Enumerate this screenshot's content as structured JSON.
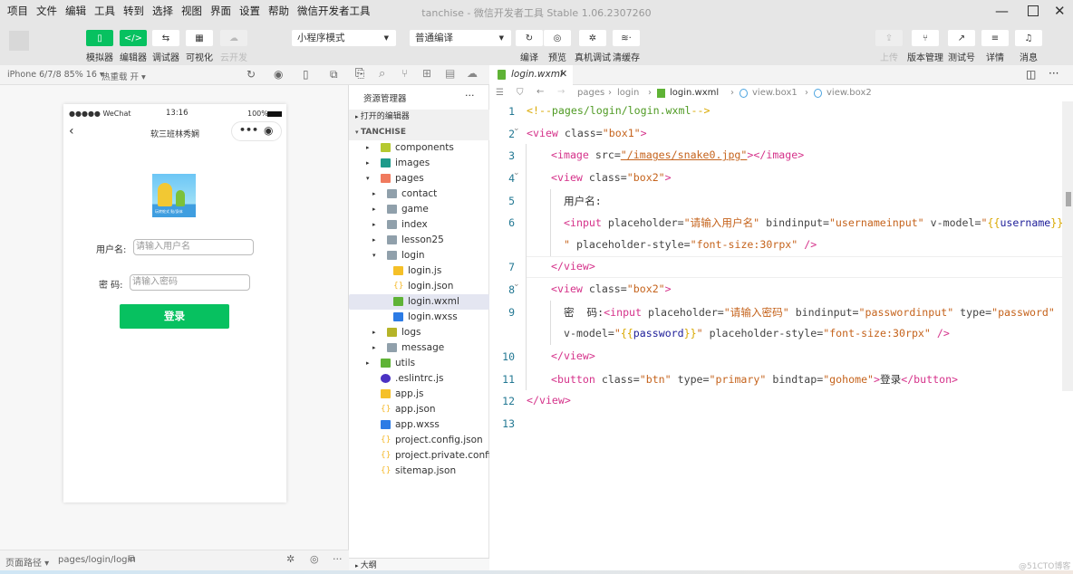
{
  "menu": [
    "项目",
    "文件",
    "编辑",
    "工具",
    "转到",
    "选择",
    "视图",
    "界面",
    "设置",
    "帮助",
    "微信开发者工具"
  ],
  "window_title": "tanchise - 微信开发者工具 Stable 1.06.2307260",
  "toolbar": {
    "left": [
      {
        "label": "模拟器",
        "icon": "phone-icon",
        "active": true
      },
      {
        "label": "编辑器",
        "icon": "code-icon",
        "active": true
      },
      {
        "label": "调试器",
        "icon": "debug-icon"
      },
      {
        "label": "可视化",
        "icon": "layout-icon"
      },
      {
        "label": "云开发",
        "icon": "cloud-icon",
        "disabled": true
      }
    ],
    "mode_select": "小程序模式",
    "compile_select": "普通编译",
    "mid": [
      {
        "label": "编译",
        "icon": "refresh-icon"
      },
      {
        "label": "预览",
        "icon": "eye-icon"
      },
      {
        "label": "真机调试",
        "icon": "bug-icon"
      },
      {
        "label": "清缓存",
        "icon": "layers-icon"
      }
    ],
    "right": [
      {
        "label": "上传",
        "icon": "upload-icon",
        "disabled": true
      },
      {
        "label": "版本管理",
        "icon": "branch-icon"
      },
      {
        "label": "测试号",
        "icon": "external-link-icon"
      },
      {
        "label": "详情",
        "icon": "menu-icon"
      },
      {
        "label": "消息",
        "icon": "bell-icon"
      }
    ]
  },
  "simbar": {
    "device": "iPhone 6/7/8 85% 16 ▾",
    "hotreload": "热重载 开 ▾"
  },
  "phone": {
    "carrier": "●●●●● WeChat",
    "time": "13:16",
    "battery": "100%",
    "nav_title": "软三班林秀娴",
    "image_caption": "玩转蛇式 贴/身体",
    "username_label": "用户名:",
    "username_placeholder": "请输入用户名",
    "password_label": "密 码:",
    "password_placeholder": "请输入密码",
    "login_button": "登录",
    "brand_color": "#07c160"
  },
  "bottom": {
    "label": "页面路径 ▾",
    "path": "pages/login/login"
  },
  "explorer": {
    "title": "资源管理器",
    "more": "···",
    "open_editors": "打开的编辑器",
    "project": "TANCHISE",
    "outline": "大纲",
    "items": [
      {
        "name": "components",
        "depth": 1,
        "type": "folder",
        "color": "#b5c930",
        "twisty": "▸"
      },
      {
        "name": "images",
        "depth": 1,
        "type": "folder",
        "color": "#1e9a8a",
        "twisty": "▸"
      },
      {
        "name": "pages",
        "depth": 1,
        "type": "folder",
        "color": "#f07a5e",
        "twisty": "▾"
      },
      {
        "name": "contact",
        "depth": 2,
        "type": "folder",
        "color": "#90a0ab",
        "twisty": "▸"
      },
      {
        "name": "game",
        "depth": 2,
        "type": "folder",
        "color": "#90a0ab",
        "twisty": "▸"
      },
      {
        "name": "index",
        "depth": 2,
        "type": "folder",
        "color": "#90a0ab",
        "twisty": "▸"
      },
      {
        "name": "lesson25",
        "depth": 2,
        "type": "folder",
        "color": "#90a0ab",
        "twisty": "▸"
      },
      {
        "name": "login",
        "depth": 2,
        "type": "folder-open",
        "color": "#90a0ab",
        "twisty": "▾"
      },
      {
        "name": "login.js",
        "depth": 3,
        "type": "js",
        "color": "#f5c028"
      },
      {
        "name": "login.json",
        "depth": 3,
        "type": "json",
        "color": "#f5b828"
      },
      {
        "name": "login.wxml",
        "depth": 3,
        "type": "wxml",
        "color": "#5fb336",
        "selected": true
      },
      {
        "name": "login.wxss",
        "depth": 3,
        "type": "wxss",
        "color": "#2c7be5"
      },
      {
        "name": "logs",
        "depth": 2,
        "type": "folder",
        "color": "#b5b428",
        "twisty": "▸"
      },
      {
        "name": "message",
        "depth": 2,
        "type": "folder",
        "color": "#90a0ab",
        "twisty": "▸"
      },
      {
        "name": "utils",
        "depth": 1,
        "type": "folder",
        "color": "#5fb336",
        "twisty": "▸"
      },
      {
        "name": ".eslintrc.js",
        "depth": 1,
        "type": "eslint",
        "color": "#4b32c3"
      },
      {
        "name": "app.js",
        "depth": 1,
        "type": "js",
        "color": "#f5c028"
      },
      {
        "name": "app.json",
        "depth": 1,
        "type": "json",
        "color": "#f5b828"
      },
      {
        "name": "app.wxss",
        "depth": 1,
        "type": "wxss",
        "color": "#2c7be5"
      },
      {
        "name": "project.config.json",
        "depth": 1,
        "type": "json",
        "color": "#f5b828"
      },
      {
        "name": "project.private.config.js...",
        "depth": 1,
        "type": "json",
        "color": "#f5b828"
      },
      {
        "name": "sitemap.json",
        "depth": 1,
        "type": "json",
        "color": "#f5b828"
      }
    ]
  },
  "editor": {
    "tab": "login.wxml",
    "breadcrumb": [
      "pages",
      "login",
      "login.wxml",
      "view.box1",
      "view.box2"
    ],
    "lines": [
      {
        "n": "1",
        "indent": 0,
        "tokens": [
          [
            "cmp",
            "<!--"
          ],
          [
            "cm",
            "pages/login/login.wxml"
          ],
          [
            "cmp",
            "-->"
          ]
        ]
      },
      {
        "n": "2",
        "indent": 0,
        "fold": true,
        "tokens": [
          [
            "tag",
            "<view "
          ],
          [
            "attr",
            "class="
          ],
          [
            "str",
            "\"box1\""
          ],
          [
            "tag",
            ">"
          ]
        ]
      },
      {
        "n": "3",
        "indent": 1,
        "tokens": [
          [
            "tag",
            "<image "
          ],
          [
            "attr",
            "src="
          ],
          [
            "str",
            "\"/images/snake0.jpg\""
          ],
          [
            "tag",
            "></image>"
          ]
        ]
      },
      {
        "n": "4",
        "indent": 1,
        "fold": true,
        "tokens": [
          [
            "tag",
            "<view "
          ],
          [
            "attr",
            "class="
          ],
          [
            "str",
            "\"box2\""
          ],
          [
            "tag",
            ">"
          ]
        ]
      },
      {
        "n": "5",
        "indent": 2,
        "tokens": [
          [
            "text",
            "用户名:"
          ]
        ]
      },
      {
        "n": "6",
        "indent": 2,
        "tokens": [
          [
            "tag",
            "<input "
          ],
          [
            "attr",
            "placeholder="
          ],
          [
            "str",
            "\"请输入用户名\""
          ],
          [
            "attr",
            " bindinput="
          ],
          [
            "str",
            "\"usernameinput\""
          ],
          [
            "attr",
            " v-model="
          ],
          [
            "str",
            "\""
          ],
          [
            "br",
            "{{"
          ],
          [
            "var",
            "username"
          ],
          [
            "br",
            "}}"
          ]
        ]
      },
      {
        "n": "",
        "indent": 2,
        "tokens": [
          [
            "str",
            "\""
          ],
          [
            "attr",
            " placeholder-style="
          ],
          [
            "str",
            "\"font-size:30rpx\""
          ],
          [
            "tag",
            " />"
          ]
        ]
      },
      {
        "n": "7",
        "indent": 1,
        "tokens": [
          [
            "tag",
            "</view>"
          ]
        ]
      },
      {
        "n": "8",
        "indent": 1,
        "fold": true,
        "tokens": [
          [
            "tag",
            "<view "
          ],
          [
            "attr",
            "class="
          ],
          [
            "str",
            "\"box2\""
          ],
          [
            "tag",
            ">"
          ]
        ]
      },
      {
        "n": "9",
        "indent": 2,
        "tokens": [
          [
            "text",
            "密  码:"
          ],
          [
            "tag",
            "<input "
          ],
          [
            "attr",
            "placeholder="
          ],
          [
            "str",
            "\"请输入密码\""
          ],
          [
            "attr",
            " bindinput="
          ],
          [
            "str",
            "\"passwordinput\""
          ],
          [
            "attr",
            " type="
          ],
          [
            "str",
            "\"password\""
          ]
        ]
      },
      {
        "n": "",
        "indent": 2,
        "tokens": [
          [
            "attr",
            "v-model="
          ],
          [
            "str",
            "\""
          ],
          [
            "br",
            "{{"
          ],
          [
            "var",
            "password"
          ],
          [
            "br",
            "}}"
          ],
          [
            "str",
            "\""
          ],
          [
            "attr",
            " placeholder-style="
          ],
          [
            "str",
            "\"font-size:30rpx\""
          ],
          [
            "tag",
            " />"
          ]
        ]
      },
      {
        "n": "10",
        "indent": 1,
        "tokens": [
          [
            "tag",
            "</view>"
          ]
        ]
      },
      {
        "n": "11",
        "indent": 1,
        "tokens": [
          [
            "tag",
            "<button "
          ],
          [
            "attr",
            "class="
          ],
          [
            "str",
            "\"btn\""
          ],
          [
            "attr",
            " type="
          ],
          [
            "str",
            "\"primary\""
          ],
          [
            "attr",
            " bindtap="
          ],
          [
            "str",
            "\"gohome\""
          ],
          [
            "tag",
            ">"
          ],
          [
            "text",
            "登录"
          ],
          [
            "tag",
            "</button>"
          ]
        ]
      },
      {
        "n": "12",
        "indent": 0,
        "tokens": [
          [
            "tag",
            "</view>"
          ]
        ]
      },
      {
        "n": "13",
        "indent": 0,
        "tokens": []
      }
    ]
  },
  "watermark": "@51CTO博客"
}
